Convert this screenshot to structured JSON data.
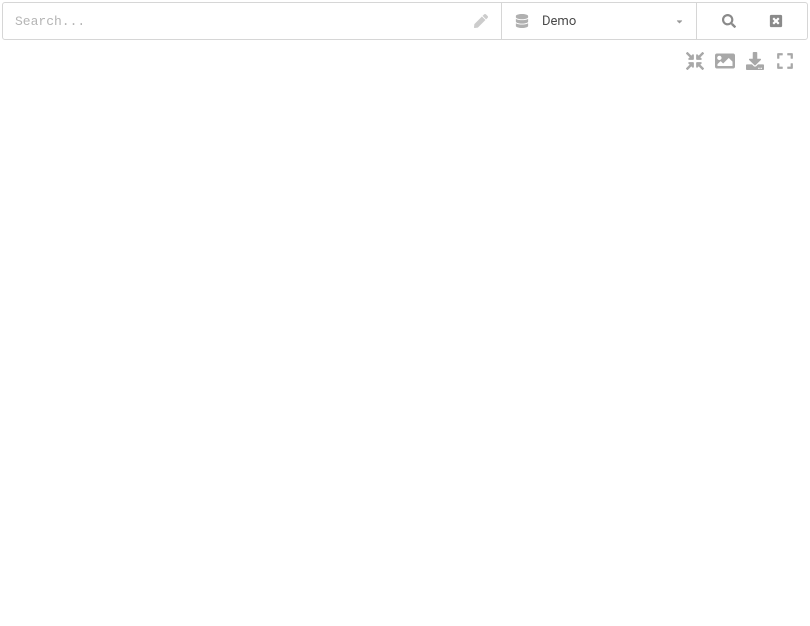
{
  "search": {
    "placeholder": "Search...",
    "value": ""
  },
  "database": {
    "selected": "Demo"
  },
  "icons": {
    "pen": "pen-icon",
    "database": "database-icon",
    "caret": "caret-down-icon",
    "search": "search-icon",
    "close": "close-icon",
    "collapse": "collapse-icon",
    "image": "image-icon",
    "download": "download-icon",
    "fullscreen": "fullscreen-icon"
  }
}
